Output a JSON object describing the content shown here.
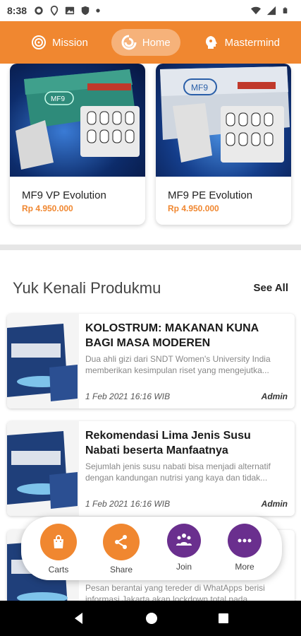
{
  "status_bar": {
    "time": "8:38",
    "left_icons": [
      "gear-icon",
      "location-icon",
      "photo-icon",
      "shield-icon",
      "dot-icon"
    ],
    "right_icons": [
      "wifi-icon",
      "signal-icon",
      "battery-icon"
    ]
  },
  "top_nav": {
    "items": [
      {
        "label": "Mission",
        "icon": "mission-icon",
        "active": false
      },
      {
        "label": "Home",
        "icon": "home-icon",
        "active": true
      },
      {
        "label": "Mastermind",
        "icon": "mastermind-icon",
        "active": false
      }
    ]
  },
  "products": [
    {
      "name": "MF9 VP Evolution",
      "price": "Rp 4.950.000",
      "box_text": "MF9"
    },
    {
      "name": "MF9 PE Evolution",
      "price": "Rp 4.950.000",
      "box_text": "MF9"
    }
  ],
  "section": {
    "title": "Yuk Kenali Produkmu",
    "see_all": "See All"
  },
  "articles": [
    {
      "title": "KOLOSTRUM: MAKANAN KUNA BAGI MASA MODEREN",
      "excerpt": "Dua ahli gizi dari SNDT Women's University India memberikan kesimpulan riset yang mengejutka...",
      "date": "1 Feb 2021 16:16 WIB",
      "author": "Admin"
    },
    {
      "title": "Rekomendasi Lima Jenis Susu Nabati beserta Manfaatnya",
      "excerpt": "Sejumlah jenis susu nabati bisa menjadi alternatif dengan kandungan nutrisi yang kaya dan tidak...",
      "date": "1 Feb 2021 16:16 WIB",
      "author": "Admin"
    },
    {
      "title": "",
      "excerpt": "Pesan berantai yang tereder di WhatApps berisi informasi Jakarta akan lockdown total pada...",
      "date": "",
      "author": ""
    }
  ],
  "action_bar": [
    {
      "label": "Carts",
      "icon": "bag-icon",
      "color": "#f08730"
    },
    {
      "label": "Share",
      "icon": "share-icon",
      "color": "#f08730"
    },
    {
      "label": "Join",
      "icon": "people-icon",
      "color": "#6a2f8e"
    },
    {
      "label": "More",
      "icon": "more-dots-icon",
      "color": "#6a2f8e"
    }
  ],
  "colors": {
    "brand_orange": "#f08730",
    "brand_purple": "#6a2f8e"
  }
}
